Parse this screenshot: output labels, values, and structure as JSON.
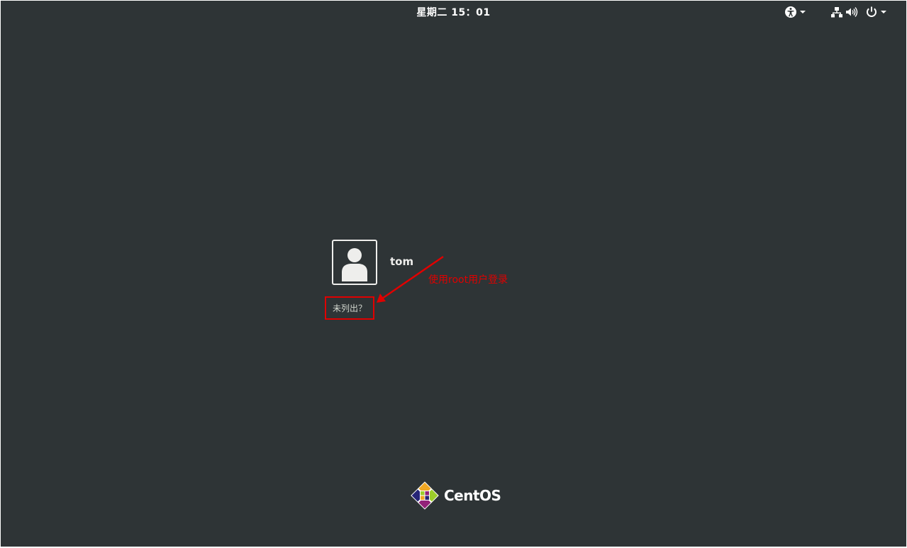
{
  "topbar": {
    "clock": "星期二 15：01",
    "icons": [
      "accessibility-icon",
      "chevron-down-icon",
      "network-icon",
      "volume-icon",
      "power-icon",
      "chevron-down-icon"
    ]
  },
  "login": {
    "user_name": "tom",
    "not_listed_label": "未列出？"
  },
  "annotation": {
    "text": "使用root用户登录",
    "color": "#e00000"
  },
  "branding": {
    "logo_text": "CentOS"
  },
  "colors": {
    "background": "#2e3436",
    "foreground": "#eeeeec"
  }
}
